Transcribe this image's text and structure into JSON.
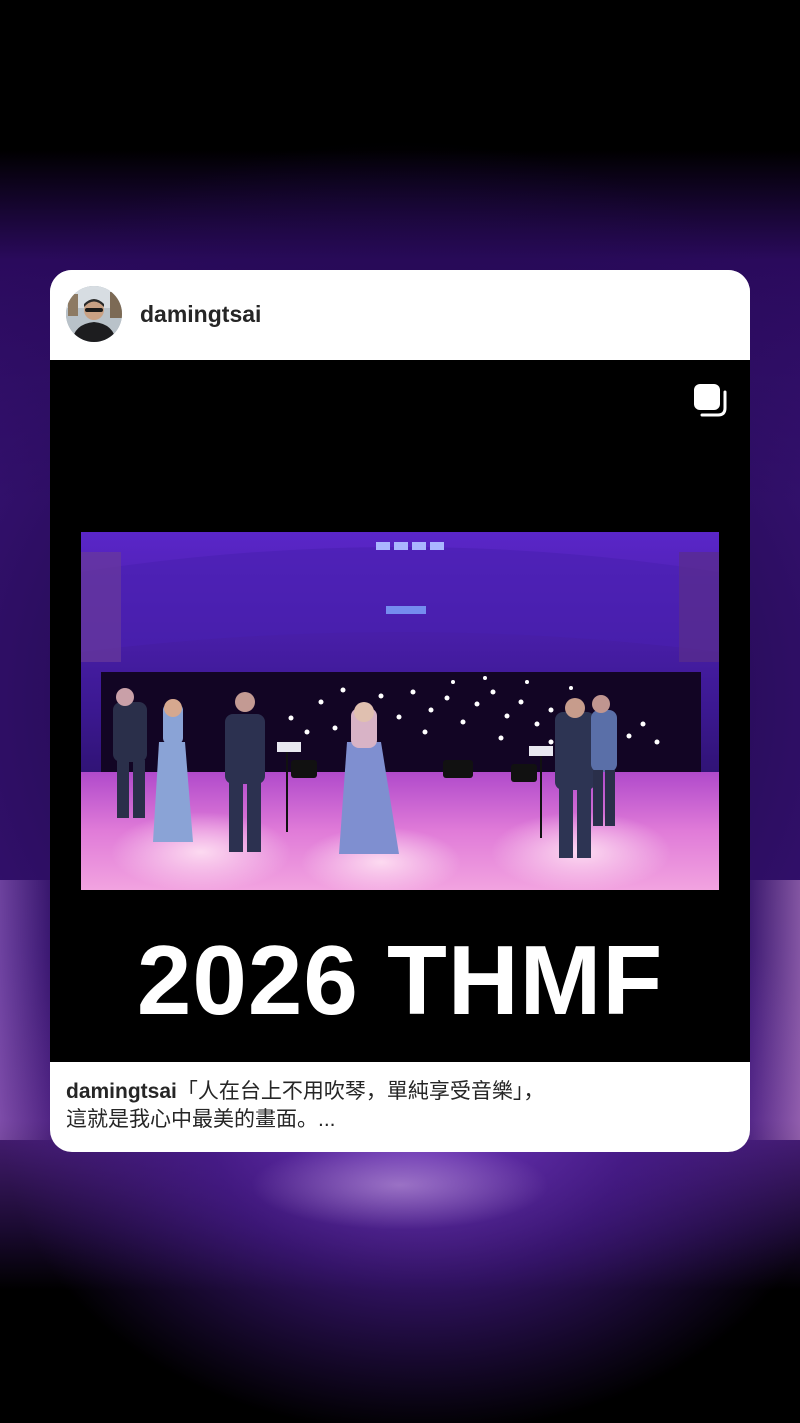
{
  "post": {
    "username": "damingtsai",
    "avatar_icon": "profile-avatar",
    "carousel_icon": "carousel-multiple-icon",
    "overlay_title": "2026 THMF",
    "caption": {
      "username": "damingtsai",
      "line1": "「人在台上不用吹琴，單純享受音樂」，",
      "line2": "這就是我心中最美的畫面。..."
    }
  },
  "colors": {
    "accent_purple": "#3a137a",
    "stage_magenta": "#d45ad8",
    "card_bg": "#ffffff",
    "text_dark": "#262626"
  }
}
